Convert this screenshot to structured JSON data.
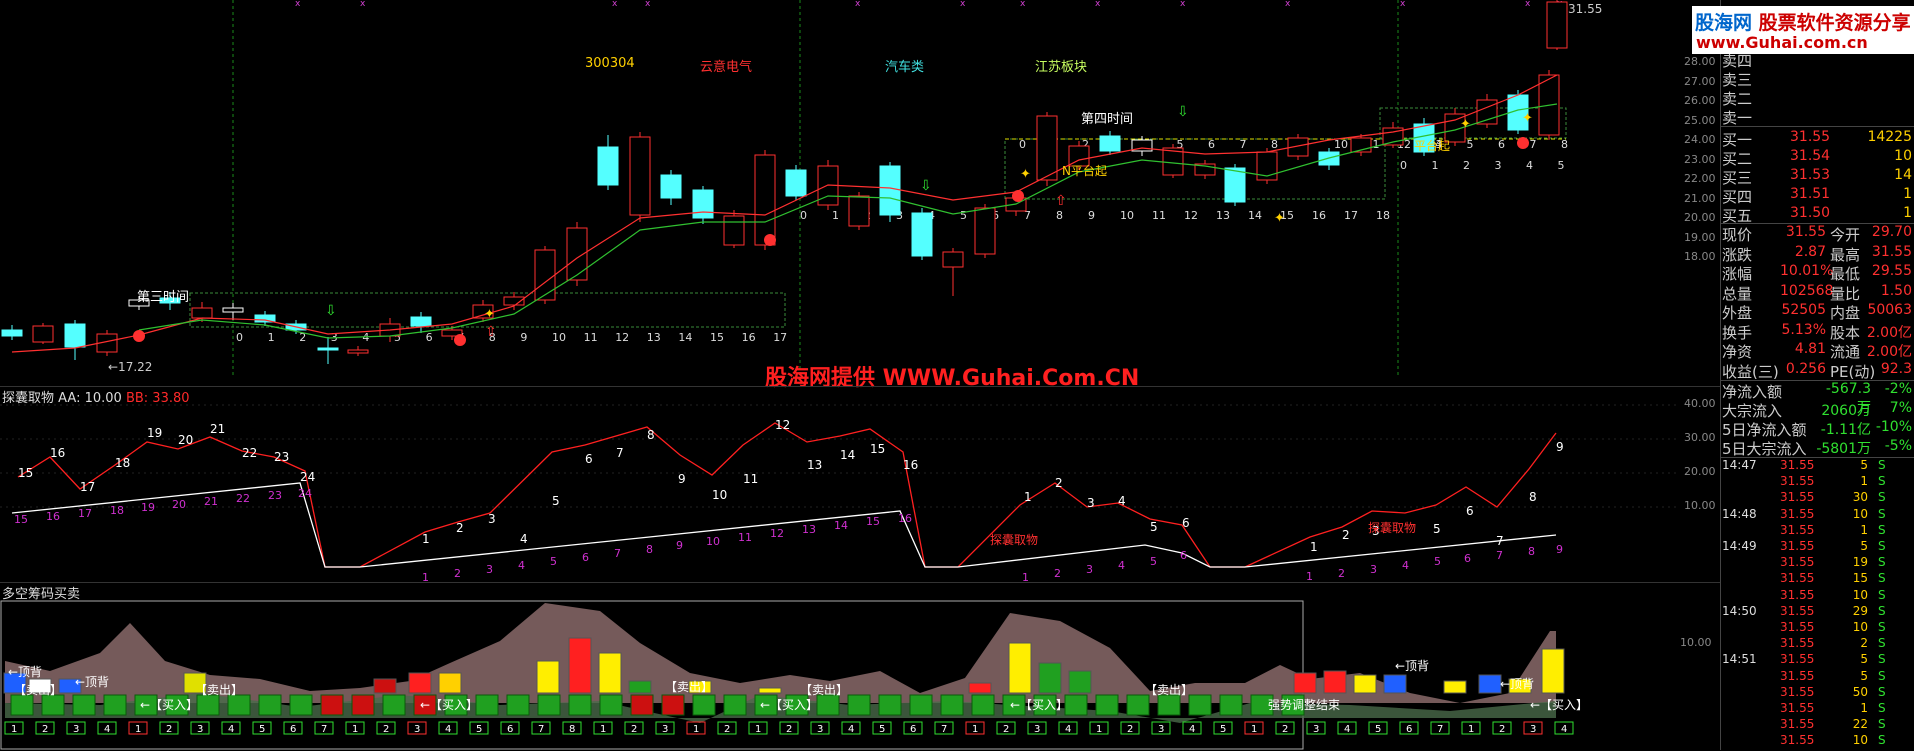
{
  "header_labels": {
    "code": "300304",
    "name": "云意电气",
    "sector1": "汽车类",
    "sector2": "江苏板块",
    "period3": "第三时间",
    "period4": "第四时间",
    "n_platform": "N平台起",
    "platform": "平台起",
    "low_price": "←17.22",
    "high_price": "31.55"
  },
  "price_axis": [
    "28.00",
    "27.00",
    "26.00",
    "25.00",
    "24.00",
    "23.00",
    "22.00",
    "21.00",
    "20.00",
    "19.00",
    "18.00"
  ],
  "watermark": "股海网提供 WWW.Guhai.Com.CN",
  "logo": {
    "line1a": "股海网",
    "line1b": "股票软件资源分享",
    "line2": "www.Guhai.com.cn"
  },
  "indicator1": {
    "name": "探囊取物",
    "aa": "AA: 10.00",
    "bb": "BB: 33.80",
    "label": "探囊取物",
    "axis": [
      "40.00",
      "30.00",
      "20.00",
      "10.00"
    ]
  },
  "indicator2": {
    "name": "多空筹码买卖",
    "axis": [
      "10.00"
    ],
    "buy": "←【买入】",
    "sell": "【卖出】",
    "top": "←顶背",
    "strong": "强势调整结束"
  },
  "orderbook": {
    "sells": [
      {
        "label": "卖四"
      },
      {
        "label": "卖三"
      },
      {
        "label": "卖二"
      },
      {
        "label": "卖一"
      }
    ],
    "buys": [
      {
        "label": "买一",
        "price": "31.55",
        "vol": "14225"
      },
      {
        "label": "买二",
        "price": "31.54",
        "vol": "10"
      },
      {
        "label": "买三",
        "price": "31.53",
        "vol": "14"
      },
      {
        "label": "买四",
        "price": "31.51",
        "vol": "1"
      },
      {
        "label": "买五",
        "price": "31.50",
        "vol": "1"
      }
    ]
  },
  "quote": [
    {
      "k1": "现价",
      "v1": "31.55",
      "k2": "今开",
      "v2": "29.70"
    },
    {
      "k1": "涨跌",
      "v1": "2.87",
      "k2": "最高",
      "v2": "31.55"
    },
    {
      "k1": "涨幅",
      "v1": "10.01%",
      "k2": "最低",
      "v2": "29.55"
    },
    {
      "k1": "总量",
      "v1": "102568",
      "k2": "量比",
      "v2": "1.50"
    },
    {
      "k1": "外盘",
      "v1": "52505",
      "k2": "内盘",
      "v2": "50063"
    },
    {
      "k1": "换手",
      "v1": "5.13%",
      "k2": "股本",
      "v2": "2.00亿"
    },
    {
      "k1": "净资",
      "v1": "4.81",
      "k2": "流通",
      "v2": "2.00亿"
    },
    {
      "k1": "收益(三)",
      "v1": "0.256",
      "k2": "PE(动)",
      "v2": "92.3"
    }
  ],
  "flows": [
    {
      "k": "净流入额",
      "v": "-567.3万",
      "p": "-2%"
    },
    {
      "k": "大宗流入",
      "v": "2060万",
      "p": "7%"
    },
    {
      "k": "5日净流入额",
      "v": "-1.11亿",
      "p": "-10%"
    },
    {
      "k": "5日大宗流入",
      "v": "-5801万",
      "p": "-5%"
    }
  ],
  "ticks": [
    {
      "t": "14:47",
      "p": "31.55",
      "v": "5",
      "s": "S"
    },
    {
      "t": "",
      "p": "31.55",
      "v": "1",
      "s": "S"
    },
    {
      "t": "",
      "p": "31.55",
      "v": "30",
      "s": "S"
    },
    {
      "t": "14:48",
      "p": "31.55",
      "v": "10",
      "s": "S"
    },
    {
      "t": "",
      "p": "31.55",
      "v": "1",
      "s": "S"
    },
    {
      "t": "14:49",
      "p": "31.55",
      "v": "5",
      "s": "S"
    },
    {
      "t": "",
      "p": "31.55",
      "v": "19",
      "s": "S"
    },
    {
      "t": "",
      "p": "31.55",
      "v": "15",
      "s": "S"
    },
    {
      "t": "",
      "p": "31.55",
      "v": "10",
      "s": "S"
    },
    {
      "t": "14:50",
      "p": "31.55",
      "v": "29",
      "s": "S"
    },
    {
      "t": "",
      "p": "31.55",
      "v": "10",
      "s": "S"
    },
    {
      "t": "",
      "p": "31.55",
      "v": "2",
      "s": "S"
    },
    {
      "t": "14:51",
      "p": "31.55",
      "v": "5",
      "s": "S"
    },
    {
      "t": "",
      "p": "31.55",
      "v": "5",
      "s": "S"
    },
    {
      "t": "",
      "p": "31.55",
      "v": "50",
      "s": "S"
    },
    {
      "t": "",
      "p": "31.55",
      "v": "1",
      "s": "S"
    },
    {
      "t": "",
      "p": "31.55",
      "v": "22",
      "s": "S"
    },
    {
      "t": "",
      "p": "31.55",
      "v": "10",
      "s": "S"
    }
  ]
}
